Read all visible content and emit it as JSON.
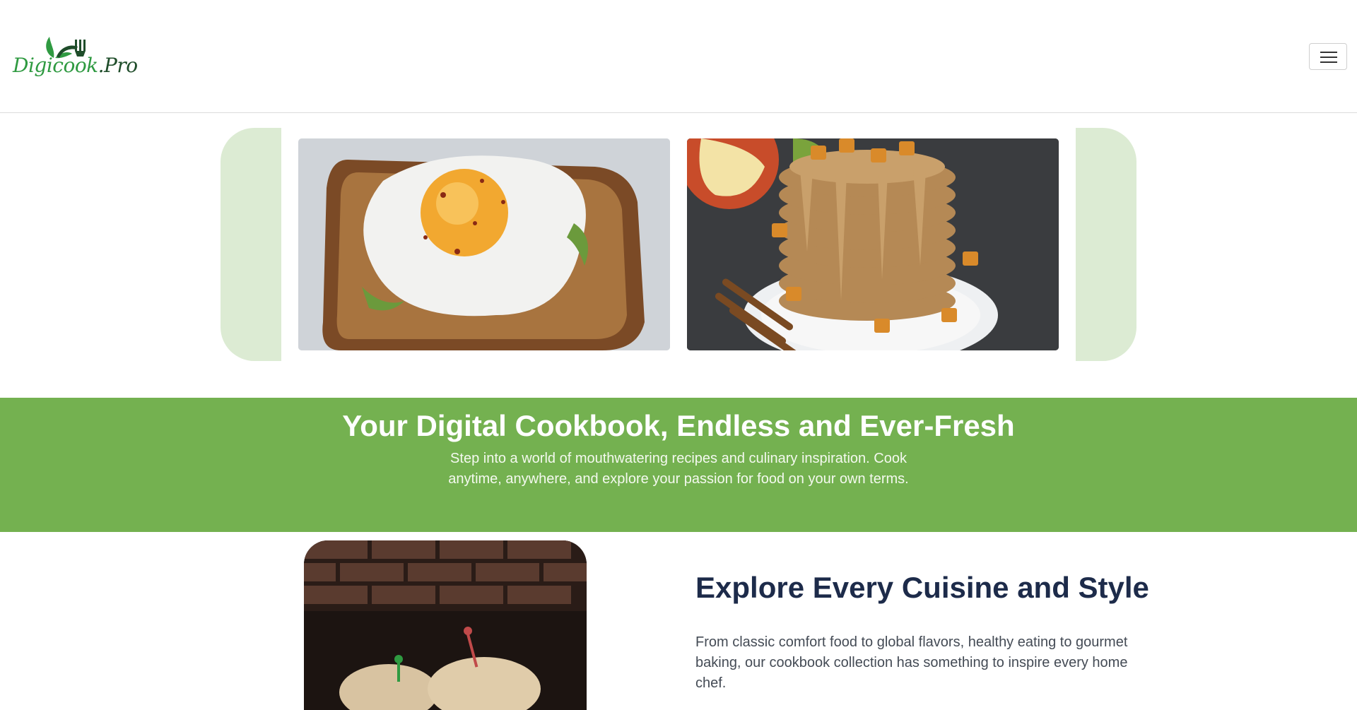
{
  "header": {
    "logo_text_main": "Digicook",
    "logo_text_suffix": ".Pro",
    "menu_icon": "hamburger-menu-icon"
  },
  "carousel": {
    "slides": [
      {
        "alt": "Fried egg on avocado toast"
      },
      {
        "alt": "Stack of pancakes with caramelized apples and nut drizzle"
      }
    ]
  },
  "banner": {
    "title": "Your Digital Cookbook, Endless and Ever-Fresh",
    "subtitle": "Step into a world of mouthwatering recipes and culinary inspiration. Cook anytime, anywhere, and explore your passion for food on your own terms."
  },
  "feature": {
    "title": "Explore Every Cuisine and Style",
    "text": "From classic comfort food to global flavors, healthy eating to gourmet baking, our cookbook collection has something to inspire every home chef.",
    "image_alt": "Burgers on a wooden board against a brick wall"
  },
  "colors": {
    "brand_green": "#74b150",
    "tab_green": "#dcebd3",
    "heading_navy": "#1d2b4a"
  }
}
